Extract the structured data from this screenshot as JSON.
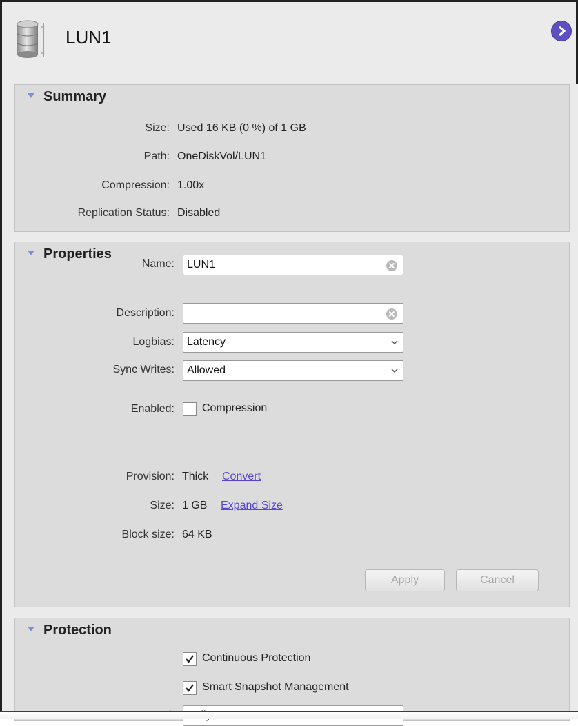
{
  "header": {
    "title": "LUN1",
    "icon": "database-icon",
    "next_icon": "chevron-right-circle-icon",
    "accent": "#5e4fc2"
  },
  "summary": {
    "title": "Summary",
    "rows": [
      {
        "label": "Size:",
        "value": "Used 16 KB (0 %) of 1 GB"
      },
      {
        "label": "Path:",
        "value": "OneDiskVol/LUN1"
      },
      {
        "label": "Compression:",
        "value": "1.00x"
      },
      {
        "label": "Replication Status:",
        "value": "Disabled"
      }
    ]
  },
  "properties": {
    "title": "Properties",
    "name_label": "Name:",
    "name_value": "LUN1",
    "description_label": "Description:",
    "description_value": "",
    "logbias_label": "Logbias:",
    "logbias_value": "Latency",
    "sync_label": "Sync Writes:",
    "sync_value": "Allowed",
    "enabled_label": "Enabled:",
    "compression_label": "Compression",
    "compression_checked": false,
    "provision_label": "Provision:",
    "provision_value": "Thick",
    "convert_link": "Convert",
    "size_label": "Size:",
    "size_value": "1 GB",
    "expand_link": "Expand Size",
    "blocksize_label": "Block size:",
    "blocksize_value": "64 KB",
    "apply_label": "Apply",
    "cancel_label": "Cancel",
    "link_color": "#5a46d6"
  },
  "protection": {
    "title": "Protection",
    "continuous_label": "Continuous Protection",
    "continuous_checked": true,
    "smart_label": "Smart Snapshot Management",
    "smart_checked": true,
    "interval_label": "Interval:",
    "interval_value": "Daily"
  }
}
